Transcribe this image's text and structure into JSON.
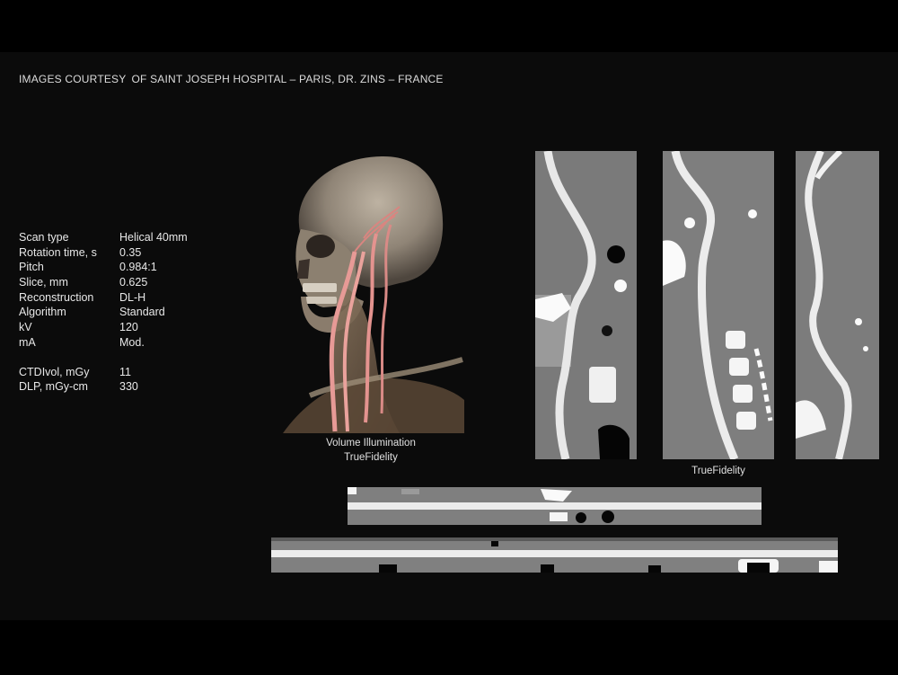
{
  "credit": {
    "prefix": "IMAGES COURTESY",
    "source": "OF SAINT JOSEPH HOSPITAL – PARIS, DR. ZINS – FRANCE"
  },
  "params": [
    {
      "key": "Scan type",
      "value": "Helical 40mm"
    },
    {
      "key": "Rotation time, s",
      "value": "0.35"
    },
    {
      "key": "Pitch",
      "value": "0.984:1"
    },
    {
      "key": "Slice, mm",
      "value": "0.625"
    },
    {
      "key": "Reconstruction",
      "value": "DL-H"
    },
    {
      "key": "Algorithm",
      "value": "Standard"
    },
    {
      "key": "kV",
      "value": "120"
    },
    {
      "key": "mA",
      "value": "Mod."
    }
  ],
  "dose": [
    {
      "key": "CTDIvol, mGy",
      "value": "11"
    },
    {
      "key": "DLP, mGy-cm",
      "value": "330"
    }
  ],
  "captions": {
    "volume_line1": "Volume Illumination",
    "volume_line2": "TrueFidelity",
    "mpr": "TrueFidelity"
  }
}
